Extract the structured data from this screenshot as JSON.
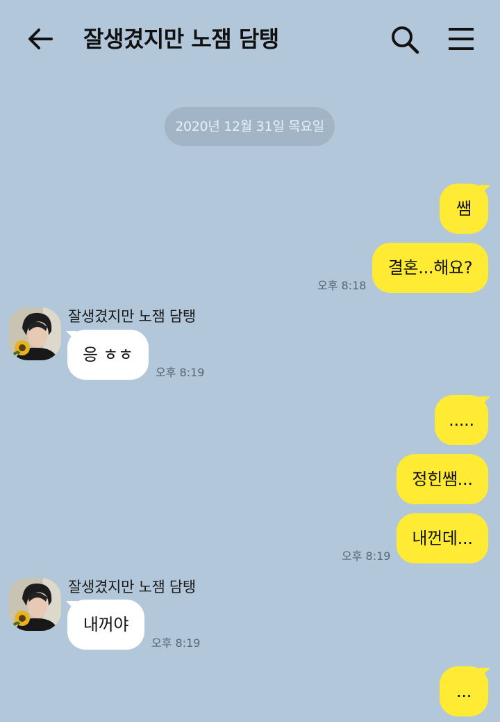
{
  "header": {
    "title": "잘생겼지만 노잼 담탱",
    "back_icon": "arrow-left-icon",
    "search_icon": "search-icon",
    "menu_icon": "hamburger-menu-icon"
  },
  "date_divider": "2020년 12월 31일 목요일",
  "colors": {
    "background": "#b2c7d9",
    "my_bubble": "#ffeb33",
    "their_bubble": "#ffffff",
    "date_pill": "#a2b5c6"
  },
  "messages": [
    {
      "sender": "me",
      "text": "쌤"
    },
    {
      "sender": "me",
      "text": "결혼...해요?",
      "time": "오후 8:18"
    },
    {
      "sender": "other",
      "name": "잘생겼지만 노잼 담탱",
      "text": "응 ㅎㅎ",
      "time": "오후 8:19"
    },
    {
      "sender": "me",
      "text": "....."
    },
    {
      "sender": "me",
      "text": "정힌쌤..."
    },
    {
      "sender": "me",
      "text": "내껀데...",
      "time": "오후 8:19"
    },
    {
      "sender": "other",
      "name": "잘생겼지만 노잼 담탱",
      "text": "내꺼야",
      "time": "오후 8:19"
    },
    {
      "sender": "me",
      "text": "..."
    }
  ]
}
